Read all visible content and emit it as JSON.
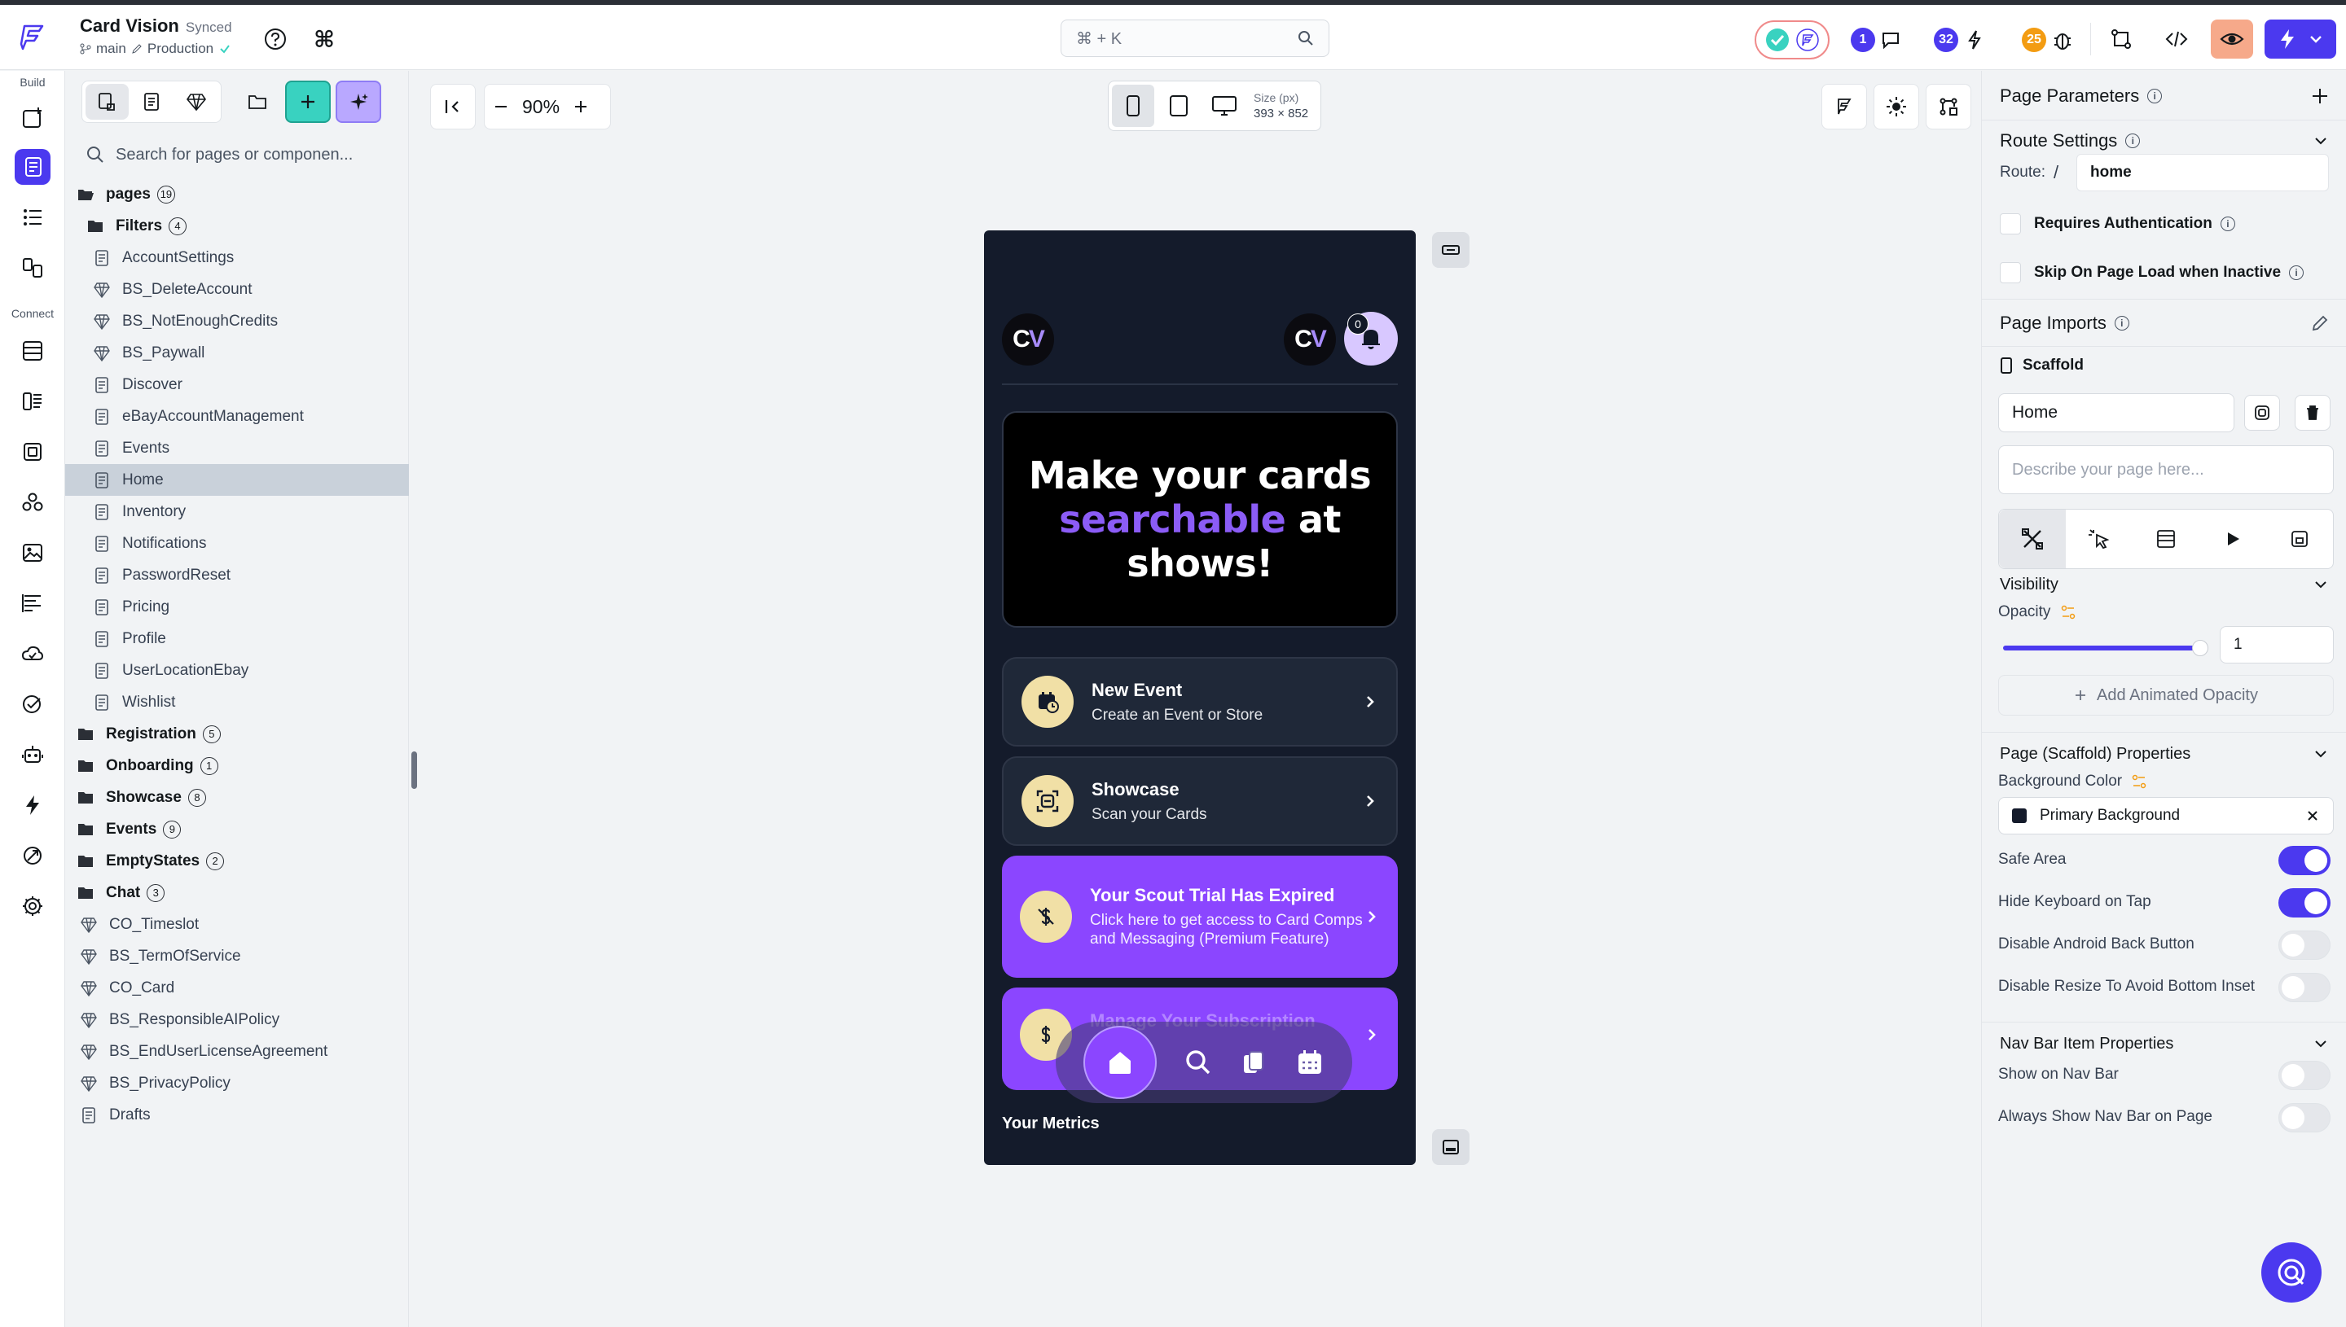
{
  "header": {
    "project_name": "Card Vision",
    "sync_status": "Synced",
    "branch": "main",
    "environment": "Production",
    "command_shortcut": "⌘ + K",
    "badges": {
      "comments": "1",
      "deploys": "32",
      "bugs": "25"
    }
  },
  "rail": {
    "build_label": "Build",
    "connect_label": "Connect"
  },
  "tree": {
    "search_placeholder": "Search for pages or componen...",
    "root": {
      "label": "pages",
      "count": "19"
    },
    "filters": {
      "label": "Filters",
      "count": "4"
    },
    "items": [
      {
        "label": "AccountSettings",
        "icon": "page-icon"
      },
      {
        "label": "BS_DeleteAccount",
        "icon": "component-icon"
      },
      {
        "label": "BS_NotEnoughCredits",
        "icon": "component-icon"
      },
      {
        "label": "BS_Paywall",
        "icon": "component-icon"
      },
      {
        "label": "Discover",
        "icon": "page-icon"
      },
      {
        "label": "eBayAccountManagement",
        "icon": "page-icon"
      },
      {
        "label": "Events",
        "icon": "page-icon"
      },
      {
        "label": "Home",
        "icon": "page-icon"
      },
      {
        "label": "Inventory",
        "icon": "page-icon"
      },
      {
        "label": "Notifications",
        "icon": "page-icon"
      },
      {
        "label": "PasswordReset",
        "icon": "page-icon"
      },
      {
        "label": "Pricing",
        "icon": "page-icon"
      },
      {
        "label": "Profile",
        "icon": "page-icon"
      },
      {
        "label": "UserLocationEbay",
        "icon": "page-icon"
      },
      {
        "label": "Wishlist",
        "icon": "page-icon"
      }
    ],
    "folders": [
      {
        "label": "Registration",
        "count": "5"
      },
      {
        "label": "Onboarding",
        "count": "1"
      },
      {
        "label": "Showcase",
        "count": "8"
      },
      {
        "label": "Events",
        "count": "9"
      },
      {
        "label": "EmptyStates",
        "count": "2"
      },
      {
        "label": "Chat",
        "count": "3"
      }
    ],
    "root_items": [
      {
        "label": "CO_Timeslot",
        "icon": "component-icon"
      },
      {
        "label": "BS_TermOfService",
        "icon": "component-icon"
      },
      {
        "label": "CO_Card",
        "icon": "component-icon"
      },
      {
        "label": "BS_ResponsibleAIPolicy",
        "icon": "component-icon"
      },
      {
        "label": "BS_EndUserLicenseAgreement",
        "icon": "component-icon"
      },
      {
        "label": "BS_PrivacyPolicy",
        "icon": "component-icon"
      },
      {
        "label": "Drafts",
        "icon": "page-icon"
      }
    ]
  },
  "canvas": {
    "zoom": "90%",
    "size_label": "Size (px)",
    "size_value": "393 × 852"
  },
  "phone": {
    "logo_text": "C",
    "logo_text_v": "V",
    "notif_count": "0",
    "hero_line1": "Make your cards",
    "hero_highlight": "searchable",
    "hero_line2_rest": " at",
    "hero_line3": "shows!",
    "cards": [
      {
        "title": "New Event",
        "subtitle": "Create an Event or Store"
      },
      {
        "title": "Showcase",
        "subtitle": "Scan your Cards"
      },
      {
        "title": "Your Scout Trial Has Expired",
        "subtitle": "Click here to get access to Card Comps and Messaging (Premium Feature)"
      },
      {
        "title": "Manage Your Subscription",
        "subtitle": ""
      }
    ],
    "metrics_label": "Your Metrics"
  },
  "props": {
    "page_parameters": "Page Parameters",
    "route_settings": "Route Settings",
    "route_label": "Route:",
    "route_slash": "/",
    "route_value": "home",
    "requires_auth": "Requires Authentication",
    "skip_on_load": "Skip On Page Load when Inactive",
    "page_imports": "Page Imports",
    "scaffold": "Scaffold",
    "page_name": "Home",
    "describe_placeholder": "Describe your page here...",
    "visibility": "Visibility",
    "opacity": "Opacity",
    "opacity_value": "1",
    "add_animated_opacity": "Add Animated Opacity",
    "scaffold_props": "Page (Scaffold) Properties",
    "bg_color_label": "Background Color",
    "bg_color_value": "Primary Background",
    "safe_area": "Safe Area",
    "hide_keyboard": "Hide Keyboard on Tap",
    "disable_android_back": "Disable Android Back Button",
    "disable_resize": "Disable Resize To Avoid Bottom Inset",
    "nav_bar_props": "Nav Bar Item Properties",
    "show_on_nav": "Show on Nav Bar",
    "always_show_nav": "Always Show Nav Bar on Page",
    "toggles": {
      "safe_area": true,
      "hide_keyboard": true,
      "disable_android_back": false,
      "disable_resize": false,
      "show_on_nav": false,
      "always_show_nav": false
    }
  },
  "colors": {
    "accent": "#4b39ef",
    "teal": "#39d2c0",
    "phone_bg": "#141b2b",
    "purple_card": "#8b46ff"
  }
}
